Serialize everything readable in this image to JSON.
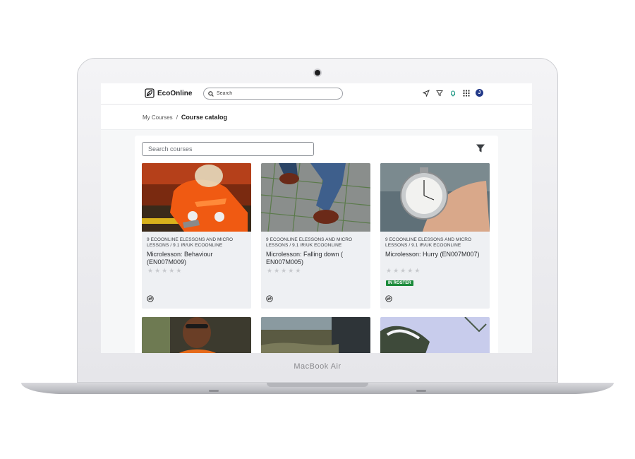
{
  "laptop": {
    "bezel_text": "MacBook Air"
  },
  "app": {
    "brand": "EcoOnline",
    "search_placeholder": "Search",
    "avatar_initial": "J",
    "icons": [
      "send-icon",
      "filter-icon",
      "bell-icon",
      "apps-grid-icon",
      "avatar"
    ]
  },
  "breadcrumb": {
    "parent": "My Courses",
    "separator": "/",
    "current": "Course catalog"
  },
  "catalog": {
    "search_placeholder": "Search courses",
    "cards": [
      {
        "meta": "9 ECOONLINE ELESSONS AND MICRO LESSONS / 9.1 IR/UK ECOONLINE",
        "title": "Microlesson: Behaviour (EN007M009)",
        "rating": 0,
        "badge": ""
      },
      {
        "meta": "9 ECOONLINE ELESSONS AND MICRO LESSONS / 9.1 IR/UK ECOONLINE",
        "title": "Microlesson: Falling down ( EN007M005)",
        "rating": 0,
        "badge": ""
      },
      {
        "meta": "9 ECOONLINE ELESSONS AND MICRO LESSONS / 9.1 IR/UK ECOONLINE",
        "title": "Microlesson: Hurry (EN007M007)",
        "rating": 0,
        "badge": "IN ROSTER"
      }
    ]
  },
  "colors": {
    "accent": "#243b8a",
    "badge_green": "#1a8a3a",
    "card_bg": "#eef0f3"
  }
}
